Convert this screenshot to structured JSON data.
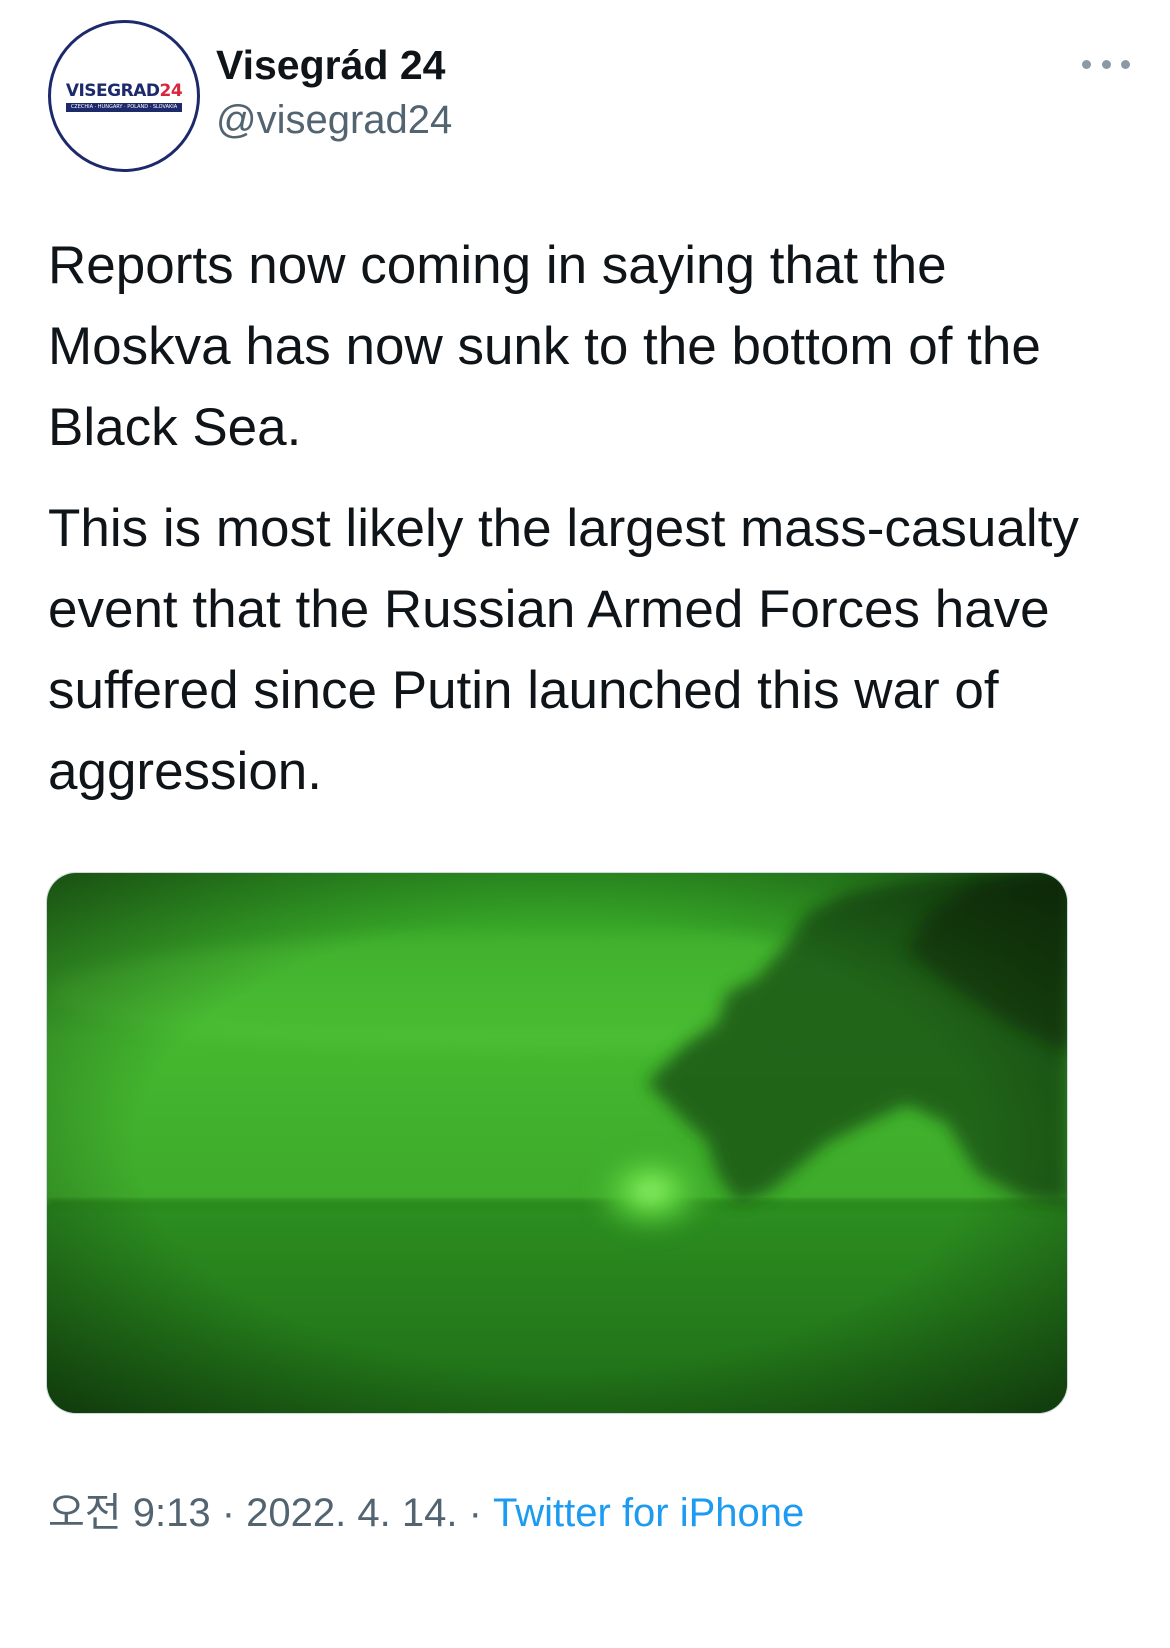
{
  "tweet": {
    "author": {
      "display_name": "Visegrád 24",
      "handle": "@visegrad24",
      "avatar": {
        "logo_word": "VISEGRAD",
        "logo_number": "24",
        "logo_strip": "CZECHIA · HUNGARY · POLAND · SLOVAKIA"
      }
    },
    "paragraphs": [
      "Reports now coming in saying that the Moskva has now sunk to the bottom of the Black Sea.",
      "This is most likely the largest mass-casualty event that the Russian Armed Forces have suffered since Putin launched this war of aggression."
    ],
    "media": {
      "type": "image",
      "style": "night-vision green"
    },
    "meta": {
      "time": "오전 9:13",
      "date": "2022. 4. 14.",
      "separator": "·",
      "source": "Twitter for iPhone"
    }
  },
  "colors": {
    "text_primary": "#0f1419",
    "text_secondary": "#536471",
    "link": "#1d9bf0",
    "logo_navy": "#1c2a6b",
    "logo_red": "#d7263d"
  },
  "icons": {
    "more": "more-horizontal-icon"
  }
}
